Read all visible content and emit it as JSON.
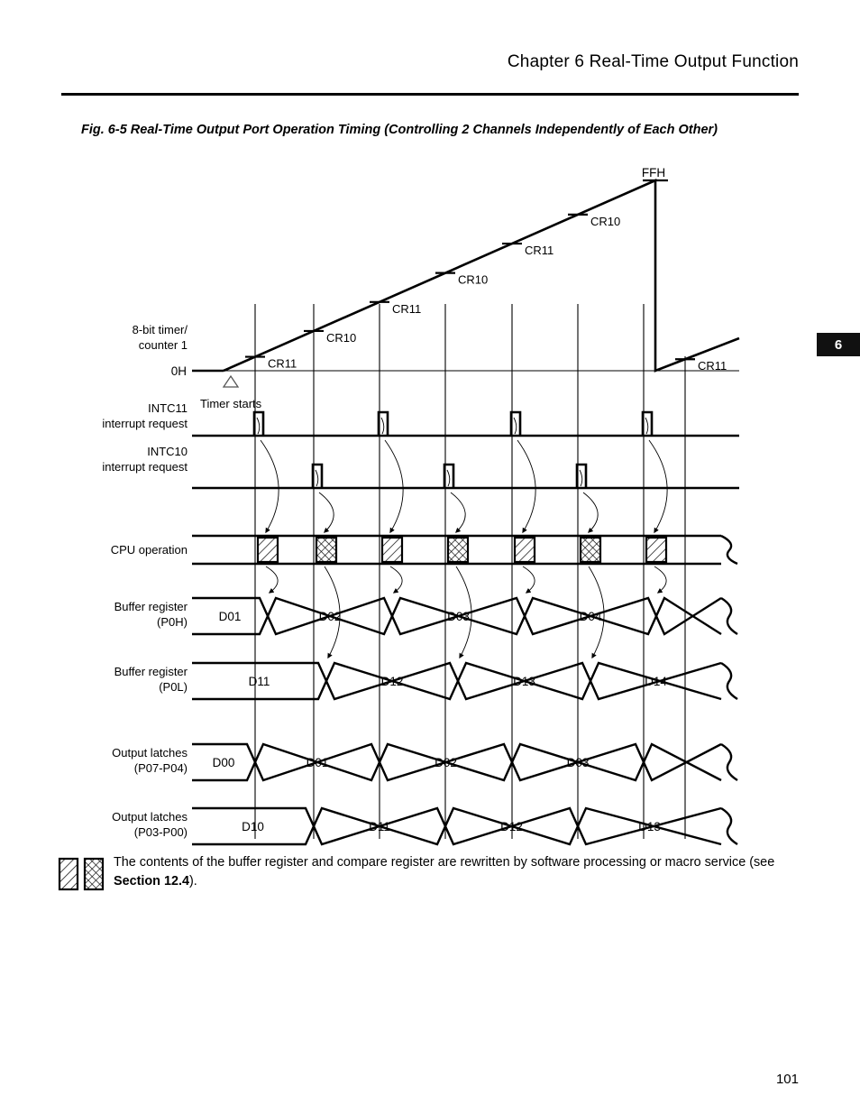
{
  "header": {
    "chapter_title": "Chapter 6   Real-Time Output Function",
    "chapter_tab": "6",
    "page_number": "101"
  },
  "figure": {
    "caption": "Fig. 6-5  Real-Time Output Port Operation Timing (Controlling 2 Channels Independently of Each Other)"
  },
  "timer": {
    "row_label_line1": "8-bit timer/",
    "row_label_line2": "counter 1",
    "zero_label": "0H",
    "max_label": "FFH",
    "start_label": "Timer starts",
    "compare_marks": [
      {
        "label": "CR11",
        "grid": 1
      },
      {
        "label": "CR10",
        "grid": 2
      },
      {
        "label": "CR11",
        "grid": 3
      },
      {
        "label": "CR10",
        "grid": 4
      },
      {
        "label": "CR11",
        "grid": 5
      },
      {
        "label": "CR10",
        "grid": 6
      },
      {
        "label": "CR11",
        "grid": 8
      }
    ]
  },
  "signals": {
    "intc11": {
      "label_line1": "INTC11",
      "label_line2": "interrupt request",
      "pulse_grids": [
        1,
        3,
        5,
        7
      ]
    },
    "intc10": {
      "label_line1": "INTC10",
      "label_line2": "interrupt request",
      "pulse_grids": [
        2,
        4,
        6
      ]
    },
    "cpu": {
      "label": "CPU operation",
      "blocks": [
        {
          "grid": 1,
          "pattern": "diagonal"
        },
        {
          "grid": 2,
          "pattern": "cross"
        },
        {
          "grid": 3,
          "pattern": "diagonal"
        },
        {
          "grid": 4,
          "pattern": "cross"
        },
        {
          "grid": 5,
          "pattern": "diagonal"
        },
        {
          "grid": 6,
          "pattern": "cross"
        },
        {
          "grid": 7,
          "pattern": "diagonal"
        }
      ]
    }
  },
  "buses": {
    "buffer_p0h": {
      "label_line1": "Buffer register",
      "label_line2": "(P0H)",
      "values": [
        "D01",
        "D02",
        "D03",
        "D04"
      ],
      "transition_grids": [
        1,
        3,
        5,
        7
      ]
    },
    "buffer_p0l": {
      "label_line1": "Buffer register",
      "label_line2": "(P0L)",
      "values": [
        "D11",
        "D12",
        "D13",
        "D14"
      ],
      "transition_grids": [
        2,
        4,
        6
      ]
    },
    "latch_high": {
      "label_line1": "Output latches",
      "label_line2": "(P07-P04)",
      "values": [
        "D00",
        "D01",
        "D02",
        "D03"
      ],
      "transition_grids": [
        1,
        3,
        5,
        7
      ]
    },
    "latch_low": {
      "label_line1": "Output latches",
      "label_line2": "(P03-P00)",
      "values": [
        "D10",
        "D11",
        "D12",
        "D13"
      ],
      "transition_grids": [
        2,
        4,
        6
      ]
    }
  },
  "footnote": {
    "text_part1": "The contents of the buffer register and compare register are rewritten by software processing or macro service  (see ",
    "text_bold": "Section 12.4",
    "text_part2": ")."
  }
}
